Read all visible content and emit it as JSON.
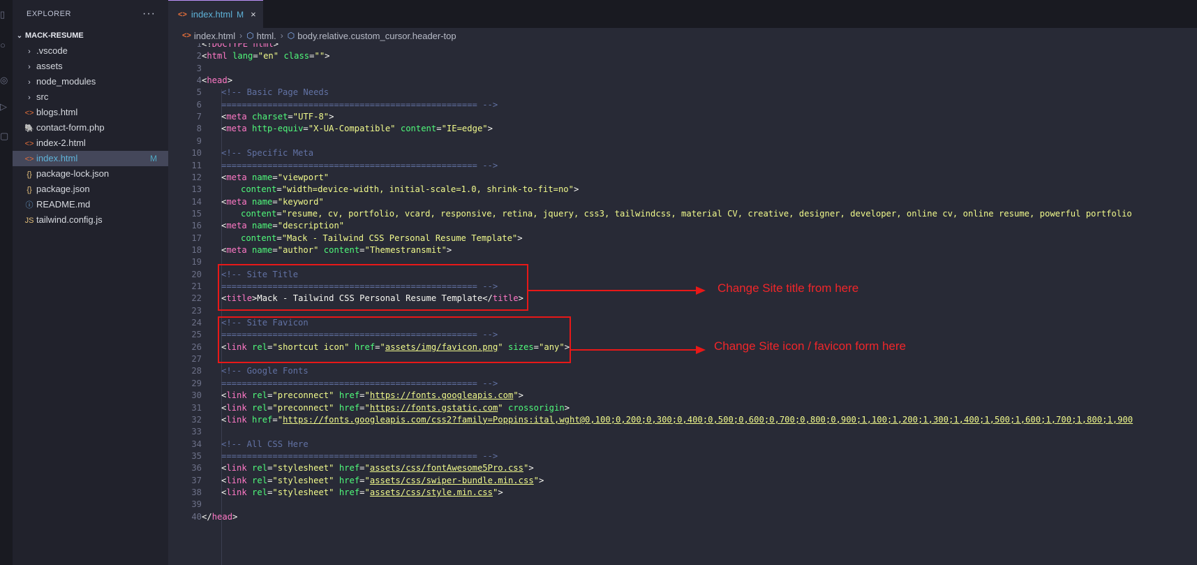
{
  "sidebar": {
    "title": "EXPLORER",
    "more": "···",
    "root": "MACK-RESUME",
    "items": [
      {
        "label": ".vscode",
        "icon": "chevron-right-icon",
        "glyph": "›",
        "color": "#c9cddb",
        "badge": ""
      },
      {
        "label": "assets",
        "icon": "chevron-right-icon",
        "glyph": "›",
        "color": "#c9cddb",
        "badge": ""
      },
      {
        "label": "node_modules",
        "icon": "chevron-right-icon",
        "glyph": "›",
        "color": "#c9cddb",
        "badge": ""
      },
      {
        "label": "src",
        "icon": "chevron-right-icon",
        "glyph": "›",
        "color": "#c9cddb",
        "badge": ""
      },
      {
        "label": "blogs.html",
        "icon": "html-file-icon",
        "glyph": "<>",
        "color": "#e8703a",
        "badge": ""
      },
      {
        "label": "contact-form.php",
        "icon": "php-file-icon",
        "glyph": "🐘",
        "color": "#a78bfa",
        "badge": ""
      },
      {
        "label": "index-2.html",
        "icon": "html-file-icon",
        "glyph": "<>",
        "color": "#e8703a",
        "badge": ""
      },
      {
        "label": "index.html",
        "icon": "html-file-icon",
        "glyph": "<>",
        "color": "#e8703a",
        "badge": "M",
        "active": true
      },
      {
        "label": "package-lock.json",
        "icon": "json-file-icon",
        "glyph": "{}",
        "color": "#e5c07b",
        "badge": ""
      },
      {
        "label": "package.json",
        "icon": "json-file-icon",
        "glyph": "{}",
        "color": "#e5c07b",
        "badge": ""
      },
      {
        "label": "README.md",
        "icon": "info-icon",
        "glyph": "ⓘ",
        "color": "#6ea7d8",
        "badge": ""
      },
      {
        "label": "tailwind.config.js",
        "icon": "js-file-icon",
        "glyph": "JS",
        "color": "#e5c07b",
        "badge": ""
      }
    ]
  },
  "tab": {
    "label": "index.html",
    "modified": "M",
    "close": "×"
  },
  "breadcrumb": {
    "file": "index.html",
    "html": "html.",
    "body": "body.relative.custom_cursor.header-top"
  },
  "code_lines": [
    {
      "n": "1",
      "indent": 0,
      "tokens": [
        [
          "p",
          "<!"
        ],
        [
          "doc",
          "DOCTYPE"
        ],
        [
          "p",
          " "
        ],
        [
          "t",
          "html"
        ],
        [
          "p",
          ">"
        ]
      ]
    },
    {
      "n": "2",
      "indent": 0,
      "tokens": [
        [
          "p",
          "<"
        ],
        [
          "t",
          "html"
        ],
        [
          "p",
          " "
        ],
        [
          "a",
          "lang"
        ],
        [
          "p",
          "="
        ],
        [
          "s",
          "\"en\""
        ],
        [
          "p",
          " "
        ],
        [
          "a",
          "class"
        ],
        [
          "p",
          "="
        ],
        [
          "s",
          "\"\""
        ],
        [
          "p",
          ">"
        ]
      ]
    },
    {
      "n": "3",
      "indent": 0,
      "tokens": []
    },
    {
      "n": "4",
      "indent": 0,
      "tokens": [
        [
          "p",
          "<"
        ],
        [
          "t",
          "head"
        ],
        [
          "p",
          ">"
        ]
      ]
    },
    {
      "n": "5",
      "indent": 1,
      "tokens": [
        [
          "c",
          "<!-- Basic Page Needs"
        ]
      ]
    },
    {
      "n": "6",
      "indent": 1,
      "tokens": [
        [
          "c",
          "================================================== -->"
        ]
      ]
    },
    {
      "n": "7",
      "indent": 1,
      "tokens": [
        [
          "p",
          "<"
        ],
        [
          "t",
          "meta"
        ],
        [
          "p",
          " "
        ],
        [
          "a",
          "charset"
        ],
        [
          "p",
          "="
        ],
        [
          "s",
          "\"UTF-8\""
        ],
        [
          "p",
          ">"
        ]
      ]
    },
    {
      "n": "8",
      "indent": 1,
      "tokens": [
        [
          "p",
          "<"
        ],
        [
          "t",
          "meta"
        ],
        [
          "p",
          " "
        ],
        [
          "a",
          "http-equiv"
        ],
        [
          "p",
          "="
        ],
        [
          "s",
          "\"X-UA-Compatible\""
        ],
        [
          "p",
          " "
        ],
        [
          "a",
          "content"
        ],
        [
          "p",
          "="
        ],
        [
          "s",
          "\"IE=edge\""
        ],
        [
          "p",
          ">"
        ]
      ]
    },
    {
      "n": "9",
      "indent": 0,
      "tokens": []
    },
    {
      "n": "10",
      "indent": 1,
      "tokens": [
        [
          "c",
          "<!-- Specific Meta"
        ]
      ]
    },
    {
      "n": "11",
      "indent": 1,
      "tokens": [
        [
          "c",
          "================================================== -->"
        ]
      ]
    },
    {
      "n": "12",
      "indent": 1,
      "tokens": [
        [
          "p",
          "<"
        ],
        [
          "t",
          "meta"
        ],
        [
          "p",
          " "
        ],
        [
          "a",
          "name"
        ],
        [
          "p",
          "="
        ],
        [
          "s",
          "\"viewport\""
        ]
      ]
    },
    {
      "n": "13",
      "indent": 2,
      "tokens": [
        [
          "a",
          "content"
        ],
        [
          "p",
          "="
        ],
        [
          "s",
          "\"width=device-width, initial-scale=1.0, shrink-to-fit=no\""
        ],
        [
          "p",
          ">"
        ]
      ]
    },
    {
      "n": "14",
      "indent": 1,
      "tokens": [
        [
          "p",
          "<"
        ],
        [
          "t",
          "meta"
        ],
        [
          "p",
          " "
        ],
        [
          "a",
          "name"
        ],
        [
          "p",
          "="
        ],
        [
          "s",
          "\"keyword\""
        ]
      ]
    },
    {
      "n": "15",
      "indent": 2,
      "tokens": [
        [
          "a",
          "content"
        ],
        [
          "p",
          "="
        ],
        [
          "s",
          "\"resume, cv, portfolio, vcard, responsive, retina, jquery, css3, tailwindcss, material CV, creative, designer, developer, online cv, online resume, powerful portfolio"
        ]
      ]
    },
    {
      "n": "16",
      "indent": 1,
      "tokens": [
        [
          "p",
          "<"
        ],
        [
          "t",
          "meta"
        ],
        [
          "p",
          " "
        ],
        [
          "a",
          "name"
        ],
        [
          "p",
          "="
        ],
        [
          "s",
          "\"description\""
        ]
      ]
    },
    {
      "n": "17",
      "indent": 2,
      "tokens": [
        [
          "a",
          "content"
        ],
        [
          "p",
          "="
        ],
        [
          "s",
          "\"Mack - Tailwind CSS Personal Resume Template\""
        ],
        [
          "p",
          ">"
        ]
      ]
    },
    {
      "n": "18",
      "indent": 1,
      "tokens": [
        [
          "p",
          "<"
        ],
        [
          "t",
          "meta"
        ],
        [
          "p",
          " "
        ],
        [
          "a",
          "name"
        ],
        [
          "p",
          "="
        ],
        [
          "s",
          "\"author\""
        ],
        [
          "p",
          " "
        ],
        [
          "a",
          "content"
        ],
        [
          "p",
          "="
        ],
        [
          "s",
          "\"Themestransmit\""
        ],
        [
          "p",
          ">"
        ]
      ]
    },
    {
      "n": "19",
      "indent": 0,
      "tokens": []
    },
    {
      "n": "20",
      "indent": 1,
      "tokens": [
        [
          "c",
          "<!-- Site Title"
        ]
      ]
    },
    {
      "n": "21",
      "indent": 1,
      "tokens": [
        [
          "c",
          "================================================== -->"
        ]
      ]
    },
    {
      "n": "22",
      "indent": 1,
      "tokens": [
        [
          "p",
          "<"
        ],
        [
          "t",
          "title"
        ],
        [
          "p",
          ">Mack - Tailwind CSS Personal Resume Template</"
        ],
        [
          "t",
          "title"
        ],
        [
          "p",
          ">"
        ]
      ]
    },
    {
      "n": "23",
      "indent": 0,
      "tokens": []
    },
    {
      "n": "24",
      "indent": 1,
      "tokens": [
        [
          "c",
          "<!-- Site Favicon"
        ]
      ]
    },
    {
      "n": "25",
      "indent": 1,
      "tokens": [
        [
          "c",
          "================================================== -->"
        ]
      ]
    },
    {
      "n": "26",
      "indent": 1,
      "tokens": [
        [
          "p",
          "<"
        ],
        [
          "t",
          "link"
        ],
        [
          "p",
          " "
        ],
        [
          "a",
          "rel"
        ],
        [
          "p",
          "="
        ],
        [
          "s",
          "\"shortcut icon\""
        ],
        [
          "p",
          " "
        ],
        [
          "a",
          "href"
        ],
        [
          "p",
          "="
        ],
        [
          "s",
          "\""
        ],
        [
          "u",
          "assets/img/favicon.png"
        ],
        [
          "s",
          "\""
        ],
        [
          "p",
          " "
        ],
        [
          "a",
          "sizes"
        ],
        [
          "p",
          "="
        ],
        [
          "s",
          "\"any\""
        ],
        [
          "p",
          ">"
        ]
      ]
    },
    {
      "n": "27",
      "indent": 0,
      "tokens": []
    },
    {
      "n": "28",
      "indent": 1,
      "tokens": [
        [
          "c",
          "<!-- Google Fonts"
        ]
      ]
    },
    {
      "n": "29",
      "indent": 1,
      "tokens": [
        [
          "c",
          "================================================== -->"
        ]
      ]
    },
    {
      "n": "30",
      "indent": 1,
      "tokens": [
        [
          "p",
          "<"
        ],
        [
          "t",
          "link"
        ],
        [
          "p",
          " "
        ],
        [
          "a",
          "rel"
        ],
        [
          "p",
          "="
        ],
        [
          "s",
          "\"preconnect\""
        ],
        [
          "p",
          " "
        ],
        [
          "a",
          "href"
        ],
        [
          "p",
          "="
        ],
        [
          "s",
          "\""
        ],
        [
          "u",
          "https://fonts.googleapis.com"
        ],
        [
          "s",
          "\""
        ],
        [
          "p",
          ">"
        ]
      ]
    },
    {
      "n": "31",
      "indent": 1,
      "tokens": [
        [
          "p",
          "<"
        ],
        [
          "t",
          "link"
        ],
        [
          "p",
          " "
        ],
        [
          "a",
          "rel"
        ],
        [
          "p",
          "="
        ],
        [
          "s",
          "\"preconnect\""
        ],
        [
          "p",
          " "
        ],
        [
          "a",
          "href"
        ],
        [
          "p",
          "="
        ],
        [
          "s",
          "\""
        ],
        [
          "u",
          "https://fonts.gstatic.com"
        ],
        [
          "s",
          "\""
        ],
        [
          "p",
          " "
        ],
        [
          "a",
          "crossorigin"
        ],
        [
          "p",
          ">"
        ]
      ]
    },
    {
      "n": "32",
      "indent": 1,
      "tokens": [
        [
          "p",
          "<"
        ],
        [
          "t",
          "link"
        ],
        [
          "p",
          " "
        ],
        [
          "a",
          "href"
        ],
        [
          "p",
          "="
        ],
        [
          "s",
          "\""
        ],
        [
          "u",
          "https://fonts.googleapis.com/css2?family=Poppins:ital,wght@0,100;0,200;0,300;0,400;0,500;0,600;0,700;0,800;0,900;1,100;1,200;1,300;1,400;1,500;1,600;1,700;1,800;1,900"
        ]
      ]
    },
    {
      "n": "33",
      "indent": 0,
      "tokens": []
    },
    {
      "n": "34",
      "indent": 1,
      "tokens": [
        [
          "c",
          "<!-- All CSS Here"
        ]
      ]
    },
    {
      "n": "35",
      "indent": 1,
      "tokens": [
        [
          "c",
          "================================================== -->"
        ]
      ]
    },
    {
      "n": "36",
      "indent": 1,
      "tokens": [
        [
          "p",
          "<"
        ],
        [
          "t",
          "link"
        ],
        [
          "p",
          " "
        ],
        [
          "a",
          "rel"
        ],
        [
          "p",
          "="
        ],
        [
          "s",
          "\"stylesheet\""
        ],
        [
          "p",
          " "
        ],
        [
          "a",
          "href"
        ],
        [
          "p",
          "="
        ],
        [
          "s",
          "\""
        ],
        [
          "u",
          "assets/css/fontAwesome5Pro.css"
        ],
        [
          "s",
          "\""
        ],
        [
          "p",
          ">"
        ]
      ]
    },
    {
      "n": "37",
      "indent": 1,
      "tokens": [
        [
          "p",
          "<"
        ],
        [
          "t",
          "link"
        ],
        [
          "p",
          " "
        ],
        [
          "a",
          "rel"
        ],
        [
          "p",
          "="
        ],
        [
          "s",
          "\"stylesheet\""
        ],
        [
          "p",
          " "
        ],
        [
          "a",
          "href"
        ],
        [
          "p",
          "="
        ],
        [
          "s",
          "\""
        ],
        [
          "u",
          "assets/css/swiper-bundle.min.css"
        ],
        [
          "s",
          "\""
        ],
        [
          "p",
          ">"
        ]
      ]
    },
    {
      "n": "38",
      "indent": 1,
      "tokens": [
        [
          "p",
          "<"
        ],
        [
          "t",
          "link"
        ],
        [
          "p",
          " "
        ],
        [
          "a",
          "rel"
        ],
        [
          "p",
          "="
        ],
        [
          "s",
          "\"stylesheet\""
        ],
        [
          "p",
          " "
        ],
        [
          "a",
          "href"
        ],
        [
          "p",
          "="
        ],
        [
          "s",
          "\""
        ],
        [
          "u",
          "assets/css/style.min.css"
        ],
        [
          "s",
          "\""
        ],
        [
          "p",
          ">"
        ]
      ]
    },
    {
      "n": "39",
      "indent": 0,
      "tokens": []
    },
    {
      "n": "40",
      "indent": 0,
      "tokens": [
        [
          "p",
          "</"
        ],
        [
          "t",
          "head"
        ],
        [
          "p",
          ">"
        ]
      ]
    }
  ],
  "annotations": {
    "title_note": "Change Site title from here",
    "favicon_note": "Change Site icon / favicon form here",
    "color": "#e81818"
  }
}
